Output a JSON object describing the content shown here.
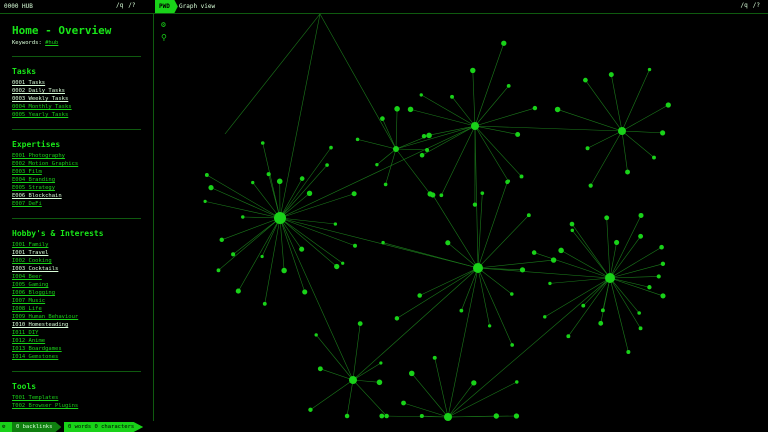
{
  "topbar": {
    "left_title": "0000 HUB",
    "left_icons": [
      "/q",
      "/?"
    ],
    "mode": "PWD",
    "right_title": "Graph view",
    "right_icons": [
      "/q",
      "/?"
    ]
  },
  "note": {
    "title": "Home - Overview",
    "keywords_label": "Keywords:",
    "keyword_tag": "#hub"
  },
  "sections": [
    {
      "title": "Tasks",
      "items": [
        {
          "label": "0001 Tasks",
          "bright": true
        },
        {
          "label": "0002 Daily Tasks",
          "bright": true
        },
        {
          "label": "0003 Weekly Tasks",
          "bright": true
        },
        {
          "label": "0004 Monthly Tasks",
          "bright": false
        },
        {
          "label": "0005 Yearly Tasks",
          "bright": false
        }
      ]
    },
    {
      "title": "Expertises",
      "items": [
        {
          "label": "E001 Photography",
          "bright": false
        },
        {
          "label": "E002 Motion Graphics",
          "bright": false
        },
        {
          "label": "E003 Film",
          "bright": false
        },
        {
          "label": "E004 Branding",
          "bright": false
        },
        {
          "label": "E005 Strategy",
          "bright": false
        },
        {
          "label": "E006 Blockchain",
          "bright": true
        },
        {
          "label": "E007 DeFi",
          "bright": false
        }
      ]
    },
    {
      "title": "Hobby's & Interests",
      "items": [
        {
          "label": "I001 Family",
          "bright": false
        },
        {
          "label": "I001 Travel",
          "bright": true
        },
        {
          "label": "I002 Cooking",
          "bright": false
        },
        {
          "label": "I003 Cocktails",
          "bright": true
        },
        {
          "label": "I004 Beer",
          "bright": false
        },
        {
          "label": "I005 Gaming",
          "bright": false
        },
        {
          "label": "I006 Blogging",
          "bright": false
        },
        {
          "label": "I007 Music",
          "bright": false
        },
        {
          "label": "I008 Life",
          "bright": false
        },
        {
          "label": "I009 Human Behaviour",
          "bright": false
        },
        {
          "label": "I010 Homesteading",
          "bright": true
        },
        {
          "label": "I011 DIY",
          "bright": false
        },
        {
          "label": "I012 Anime",
          "bright": false
        },
        {
          "label": "I013 Boardgames",
          "bright": false
        },
        {
          "label": "I014 Gemstones",
          "bright": false
        }
      ]
    },
    {
      "title": "Tools",
      "items": [
        {
          "label": "T001 Templates",
          "bright": false
        },
        {
          "label": "T002 Browser Plugins",
          "bright": false
        }
      ]
    }
  ],
  "status": {
    "backlinks": "0 backlinks",
    "words": "0 words 0 characters"
  },
  "colors": {
    "accent": "#19d219",
    "bg": "#000000",
    "edge": "#1b7a1b"
  }
}
